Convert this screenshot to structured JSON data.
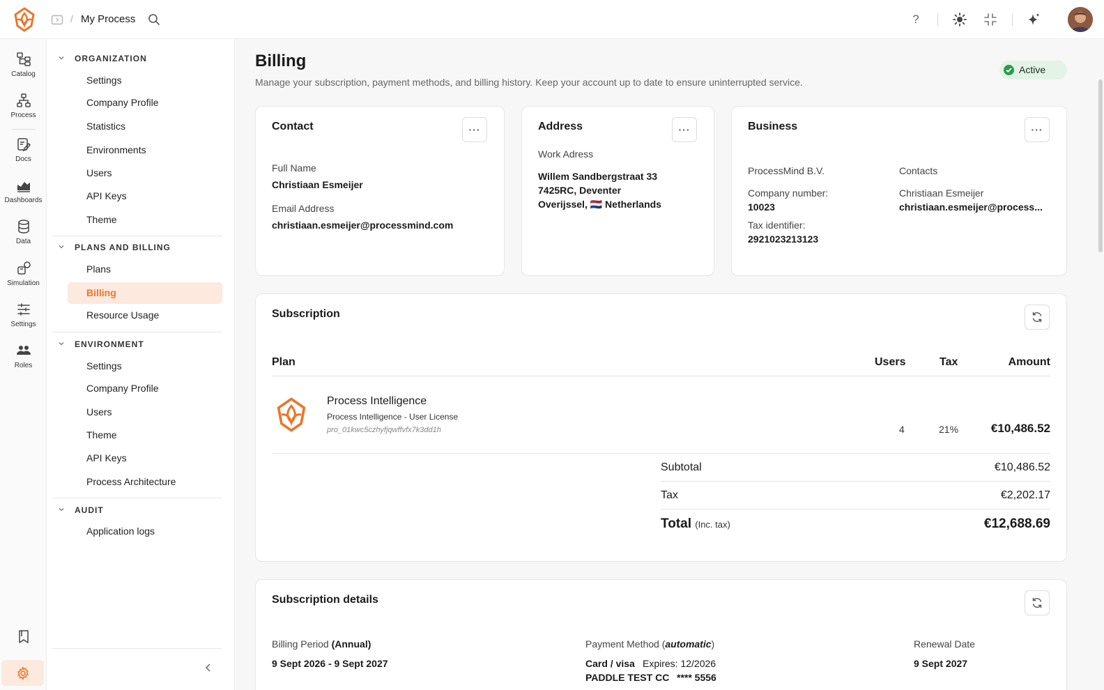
{
  "topbar": {
    "breadcrumb_separator": "/",
    "title": "My Process",
    "icons": [
      "help-icon",
      "sun-icon",
      "collapse-icon",
      "sparkle-icon"
    ],
    "help_text": "?"
  },
  "rail": {
    "items": [
      {
        "label": "Catalog",
        "icon": "catalog-icon"
      },
      {
        "label": "Process",
        "icon": "process-icon"
      },
      {
        "label": "Docs",
        "icon": "docs-icon"
      },
      {
        "label": "Dashboards",
        "icon": "dashboards-icon"
      },
      {
        "label": "Data",
        "icon": "data-icon"
      },
      {
        "label": "Simulation",
        "icon": "simulation-icon"
      },
      {
        "label": "Settings",
        "icon": "settings-icon"
      },
      {
        "label": "Roles",
        "icon": "roles-icon"
      }
    ]
  },
  "nav": {
    "sections": [
      {
        "title": "ORGANIZATION",
        "items": [
          "Settings",
          "Company Profile",
          "Statistics",
          "Environments",
          "Users",
          "API Keys",
          "Theme"
        ]
      },
      {
        "title": "PLANS AND BILLING",
        "items": [
          "Plans",
          "Billing",
          "Resource Usage"
        ]
      },
      {
        "title": "ENVIRONMENT",
        "items": [
          "Settings",
          "Company Profile",
          "Users",
          "Theme",
          "API Keys",
          "Process Architecture"
        ]
      },
      {
        "title": "AUDIT",
        "items": [
          "Application logs"
        ]
      }
    ],
    "active_item": "Billing"
  },
  "page": {
    "title": "Billing",
    "subtitle": "Manage your subscription, payment methods, and billing history. Keep your account up to date to ensure uninterrupted service.",
    "status": "Active"
  },
  "contact": {
    "title": "Contact",
    "name_label": "Full Name",
    "name": "Christiaan Esmeijer",
    "email_label": "Email Address",
    "email": "christiaan.esmeijer@processmind.com",
    "menu": "···"
  },
  "address": {
    "title": "Address",
    "label": "Work Adress",
    "line1": "Willem Sandbergstraat 33",
    "line2": "7425RC, Deventer",
    "line3_region": "Overijssel,",
    "line3_flag": "🇳🇱",
    "line3_country": "Netherlands",
    "menu": "···"
  },
  "business": {
    "title": "Business",
    "company": "ProcessMind B.V.",
    "company_number_label": "Company number:",
    "company_number": "10023",
    "tax_id_label": "Tax identifier:",
    "tax_id": "2921023213123",
    "contacts_label": "Contacts",
    "contact_name": "Christiaan Esmeijer",
    "contact_email": "christiaan.esmeijer@process...",
    "menu": "···"
  },
  "subscription": {
    "title": "Subscription",
    "columns": {
      "plan": "Plan",
      "users": "Users",
      "tax": "Tax",
      "amount": "Amount"
    },
    "line": {
      "name": "Process Intelligence",
      "description": "Process Intelligence - User License",
      "id": "pro_01kwc5czhyfjqwffvfx7k3dd1h",
      "users": "4",
      "tax": "21%",
      "amount": "€10,486.52"
    },
    "subtotal_label": "Subtotal",
    "subtotal": "€10,486.52",
    "tax_label": "Tax",
    "tax_total": "€2,202.17",
    "total_label": "Total",
    "total_note": "(Inc. tax)",
    "total": "€12,688.69"
  },
  "details": {
    "title": "Subscription details",
    "period_label": "Billing Period",
    "period_kind": "(Annual)",
    "period": "9 Sept 2026 - 9 Sept 2027",
    "payment_label": "Payment Method (",
    "payment_kind": "automatic",
    "payment_close": ")",
    "card_type": "Card / visa",
    "card_expiry": "Expires: 12/2026",
    "card_holder": "PADDLE TEST CC",
    "card_number": "**** 5556",
    "renewal_label": "Renewal Date",
    "renewal": "9 Sept 2027"
  },
  "colors": {
    "accent": "#e8772e",
    "accent_soft": "#fde9dd",
    "success": "#2d9b4a"
  }
}
